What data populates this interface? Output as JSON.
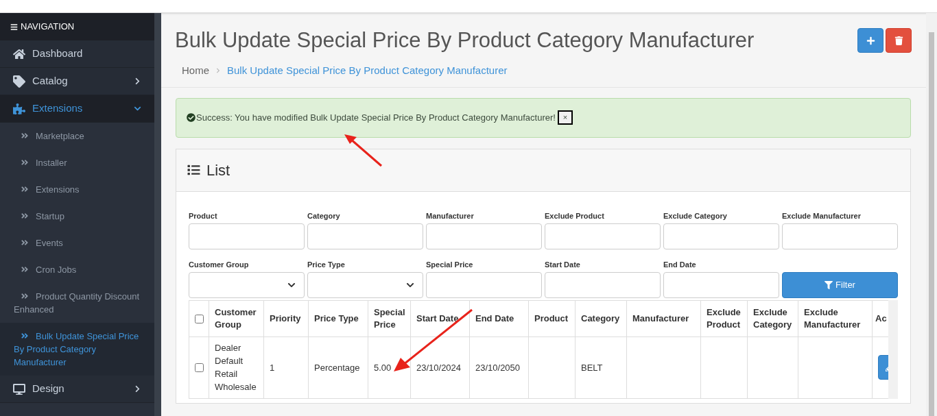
{
  "sidebar": {
    "heading": "NAVIGATION",
    "items": [
      {
        "label": "Dashboard",
        "kind": "link",
        "selected": false
      },
      {
        "label": "Catalog",
        "kind": "menu",
        "selected": false,
        "expanded": false
      },
      {
        "label": "Extensions",
        "kind": "menu",
        "selected": true,
        "expanded": true,
        "children": [
          {
            "label": "Marketplace",
            "selected": false
          },
          {
            "label": "Installer",
            "selected": false
          },
          {
            "label": "Extensions",
            "selected": false
          },
          {
            "label": "Startup",
            "selected": false
          },
          {
            "label": "Events",
            "selected": false
          },
          {
            "label": "Cron Jobs",
            "selected": false
          },
          {
            "label": "Product Quantity Discount Enhanced",
            "selected": false
          },
          {
            "label": "Bulk Update Special Price By Product Category Manufacturer",
            "selected": true
          }
        ]
      },
      {
        "label": "Design",
        "kind": "menu",
        "selected": false,
        "expanded": false
      }
    ]
  },
  "page": {
    "title": "Bulk Update Special Price By Product Category Manufacturer",
    "breadcrumb": [
      "Home",
      "Bulk Update Special Price By Product Category Manufacturer"
    ]
  },
  "alert": {
    "text": "Success: You have modified Bulk Update Special Price By Product Category Manufacturer!",
    "close": "×"
  },
  "panel": {
    "title": "List",
    "filters": [
      {
        "label": "Product",
        "kind": "text"
      },
      {
        "label": "Category",
        "kind": "text"
      },
      {
        "label": "Manufacturer",
        "kind": "text"
      },
      {
        "label": "Exclude Product",
        "kind": "text"
      },
      {
        "label": "Exclude Category",
        "kind": "text"
      },
      {
        "label": "Exclude Manufacturer",
        "kind": "text"
      },
      {
        "label": "Customer Group",
        "kind": "select"
      },
      {
        "label": "Price Type",
        "kind": "select"
      },
      {
        "label": "Special Price",
        "kind": "text"
      },
      {
        "label": "Start Date",
        "kind": "text"
      },
      {
        "label": "End Date",
        "kind": "text"
      }
    ],
    "filter_button": "Filter",
    "table": {
      "all_checked": false,
      "columns": [
        "Customer Group",
        "Priority",
        "Price Type",
        "Special Price",
        "Start Date",
        "End Date",
        "Product",
        "Category",
        "Manufacturer",
        "Exclude Product",
        "Exclude Category",
        "Exclude Manufacturer",
        "Ac"
      ],
      "rows": [
        {
          "checked": false,
          "cells": [
            "Dealer Default Retail Wholesale",
            "1",
            "Percentage",
            "5.00",
            "23/10/2024",
            "23/10/2050",
            "",
            "BELT",
            "",
            "",
            "",
            "",
            ""
          ]
        }
      ]
    }
  }
}
